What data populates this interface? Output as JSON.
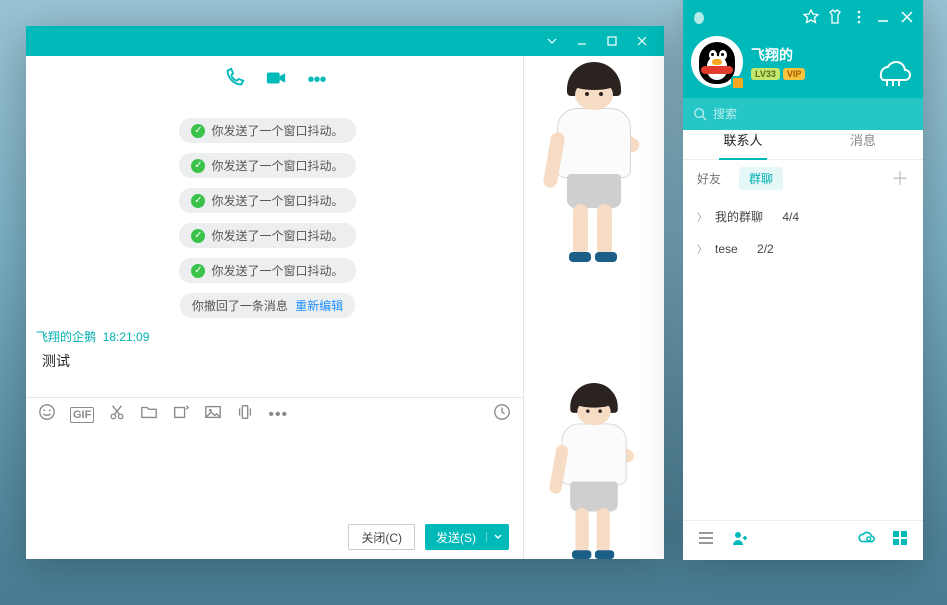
{
  "chat": {
    "titlebar": {
      "title": "         "
    },
    "calls": {
      "phone": "phone",
      "video": "video",
      "more": "•••"
    },
    "shake_msg": "你发送了一个窗口抖动。",
    "shake_count": 5,
    "recall": {
      "text": "你撤回了一条消息",
      "link": "重新编辑"
    },
    "sender": {
      "name": "飞翔的企鹅",
      "time": "18:21:09"
    },
    "message": "测试",
    "buttons": {
      "close": "关闭(C)",
      "send": "发送(S)"
    }
  },
  "panel": {
    "name": "飞翔的",
    "badges": {
      "lv": "LV33",
      "vip": "VIP"
    },
    "search_placeholder": "搜索",
    "tabs": {
      "contacts": "联系人",
      "messages": "消息"
    },
    "subtabs": {
      "friends": "好友",
      "groups": "群聊"
    },
    "groups": [
      {
        "name": "我的群聊",
        "count": "4/4"
      },
      {
        "name": "tese",
        "count": "2/2"
      }
    ]
  }
}
